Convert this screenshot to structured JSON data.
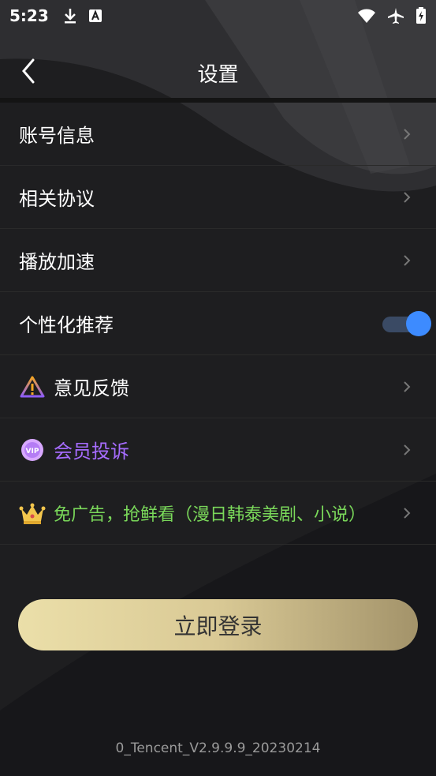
{
  "status_bar": {
    "time": "5:23",
    "left_icons": [
      "download-icon",
      "font-a-icon"
    ],
    "right_icons": [
      "wifi-icon",
      "airplane-icon",
      "battery-icon"
    ]
  },
  "header": {
    "title": "设置",
    "back_icon": "back-arrow-icon"
  },
  "menu": {
    "items": [
      {
        "label": "账号信息",
        "trailing": "chevron-right-icon"
      },
      {
        "label": "相关协议",
        "trailing": "chevron-right-icon"
      },
      {
        "label": "播放加速",
        "trailing": "chevron-right-icon"
      },
      {
        "label": "个性化推荐",
        "trailing": "toggle",
        "toggle_on": true
      },
      {
        "label": "意见反馈",
        "icon": "warning-triangle-icon",
        "trailing": "chevron-right-icon"
      },
      {
        "label": "会员投诉",
        "icon": "vip-badge-icon",
        "color": "#a66cff",
        "trailing": "chevron-right-icon"
      },
      {
        "label": "免广告，抢鲜看（漫日韩泰美剧、小说）",
        "icon": "crown-icon",
        "color": "#7ad85a",
        "trailing": "chevron-right-icon"
      }
    ]
  },
  "login_button": {
    "label": "立即登录"
  },
  "version": "0_Tencent_V2.9.9.9_20230214",
  "colors": {
    "background": "#1c1c1e",
    "accent_toggle": "#3d8bff",
    "vip_purple": "#a66cff",
    "promo_green": "#7ad85a",
    "login_gold": "#ebdfa9"
  }
}
